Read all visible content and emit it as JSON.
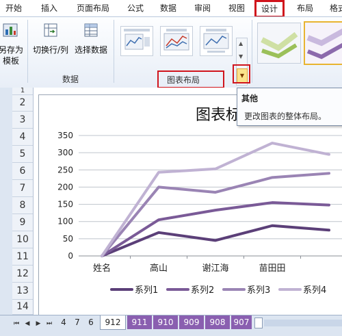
{
  "ribbon": {
    "tabs": [
      {
        "label": "开始"
      },
      {
        "label": "插入"
      },
      {
        "label": "页面布局"
      },
      {
        "label": "公式"
      },
      {
        "label": "数据"
      },
      {
        "label": "审阅"
      },
      {
        "label": "视图"
      },
      {
        "label": "设计",
        "active": true
      },
      {
        "label": "布局"
      },
      {
        "label": "格式"
      }
    ],
    "groups": {
      "type": {
        "btn_line1": "另存为",
        "btn_line2": "模板"
      },
      "data": {
        "switch_label": "切换行/列",
        "select_label": "选择数据",
        "group_label": "数据"
      },
      "layout": {
        "group_label": "图表布局"
      }
    },
    "more_button_glyph": "▼"
  },
  "tooltip": {
    "title": "其他",
    "body": "更改图表的整体布局。"
  },
  "rows": [
    "1",
    "2",
    "3",
    "4",
    "5",
    "6",
    "7",
    "8",
    "9",
    "10",
    "11",
    "12",
    "13",
    "14"
  ],
  "sheet_tabs": {
    "tabs": [
      "4",
      "7",
      "6",
      "912",
      "911",
      "910",
      "909",
      "908",
      "907"
    ],
    "active": "912"
  },
  "chart_data": {
    "type": "line",
    "title": "图表标",
    "categories": [
      "姓名",
      "高山",
      "谢江海",
      "苗田田",
      ""
    ],
    "ylim": [
      0,
      350
    ],
    "yticks": [
      0,
      50,
      100,
      150,
      200,
      250,
      300,
      350
    ],
    "grid": true,
    "legend_position": "bottom",
    "series": [
      {
        "name": "系列1",
        "color": "#5b3f78",
        "values": [
          0,
          68,
          45,
          88,
          75
        ]
      },
      {
        "name": "系列2",
        "color": "#7a5a97",
        "values": [
          0,
          105,
          133,
          155,
          148
        ]
      },
      {
        "name": "系列3",
        "color": "#9a84b4",
        "values": [
          0,
          200,
          185,
          228,
          240
        ]
      },
      {
        "name": "系列4",
        "color": "#c0b2d3",
        "values": [
          0,
          243,
          253,
          328,
          295
        ]
      }
    ]
  }
}
